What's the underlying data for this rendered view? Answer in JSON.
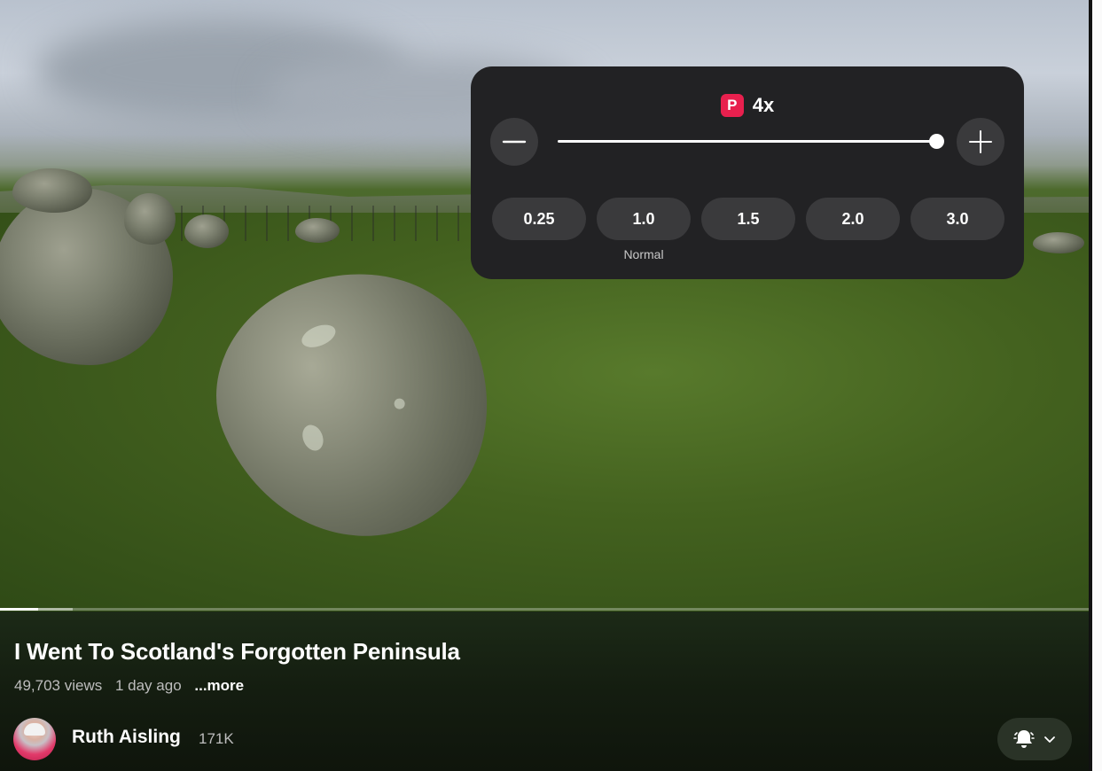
{
  "player": {
    "progress_fraction": 0.035,
    "buffer_fraction": 0.067
  },
  "speed_panel": {
    "badge": "P",
    "current_speed": "4x",
    "slider_fraction": 1.0,
    "presets": [
      {
        "label": "0.25",
        "note": ""
      },
      {
        "label": "1.0",
        "note": "Normal"
      },
      {
        "label": "1.5",
        "note": ""
      },
      {
        "label": "2.0",
        "note": ""
      },
      {
        "label": "3.0",
        "note": ""
      }
    ],
    "icons": {
      "decrease": "minus-icon",
      "increase": "plus-icon"
    }
  },
  "video": {
    "title": "I Went To Scotland's Forgotten Peninsula",
    "views": "49,703 views",
    "age": "1 day ago",
    "more": "...more"
  },
  "channel": {
    "name": "Ruth Aisling",
    "subscribers": "171K",
    "notification_icon": "bell-icon",
    "dropdown_icon": "chevron-down-icon"
  },
  "colors": {
    "badge": "#e8204e",
    "panel": "#222224",
    "button": "#3a3a3c"
  }
}
